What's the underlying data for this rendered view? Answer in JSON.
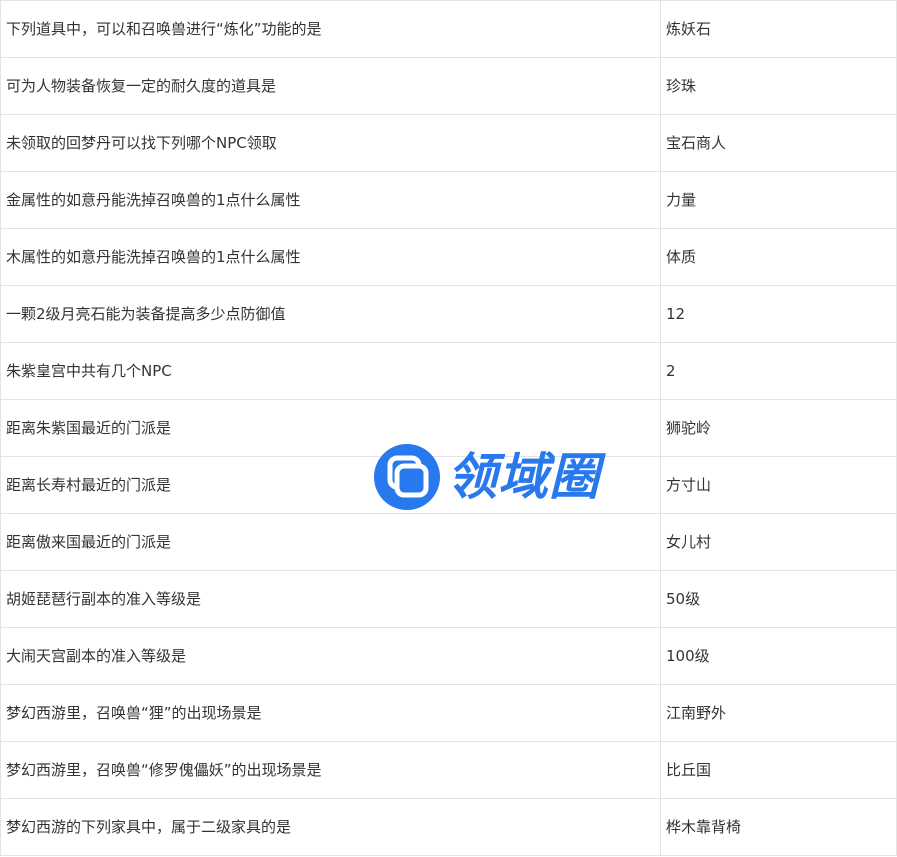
{
  "rows": [
    {
      "question": "下列道具中，可以和召唤兽进行“炼化”功能的是",
      "answer": "炼妖石"
    },
    {
      "question": "可为人物装备恢复一定的耐久度的道具是",
      "answer": "珍珠"
    },
    {
      "question": "未领取的回梦丹可以找下列哪个NPC领取",
      "answer": "宝石商人"
    },
    {
      "question": "金属性的如意丹能洗掉召唤兽的1点什么属性",
      "answer": "力量"
    },
    {
      "question": "木属性的如意丹能洗掉召唤兽的1点什么属性",
      "answer": "体质"
    },
    {
      "question": "一颗2级月亮石能为装备提高多少点防御值",
      "answer": "12"
    },
    {
      "question": "朱紫皇宫中共有几个NPC",
      "answer": "2"
    },
    {
      "question": "距离朱紫国最近的门派是",
      "answer": "狮驼岭"
    },
    {
      "question": "距离长寿村最近的门派是",
      "answer": "方寸山"
    },
    {
      "question": "距离傲来国最近的门派是",
      "answer": "女儿村"
    },
    {
      "question": "胡姬琵琶行副本的准入等级是",
      "answer": "50级"
    },
    {
      "question": "大闹天宫副本的准入等级是",
      "answer": "100级"
    },
    {
      "question": "梦幻西游里，召唤兽“狸”的出现场景是",
      "answer": "江南野外"
    },
    {
      "question": "梦幻西游里，召唤兽“修罗傀儡妖”的出现场景是",
      "answer": "比丘国"
    },
    {
      "question": "梦幻西游的下列家具中，属于二级家具的是",
      "answer": "桦木靠背椅"
    }
  ],
  "watermark": {
    "text": "领域圈",
    "color": "#2878ee",
    "icon": "watermark-logo-icon"
  }
}
